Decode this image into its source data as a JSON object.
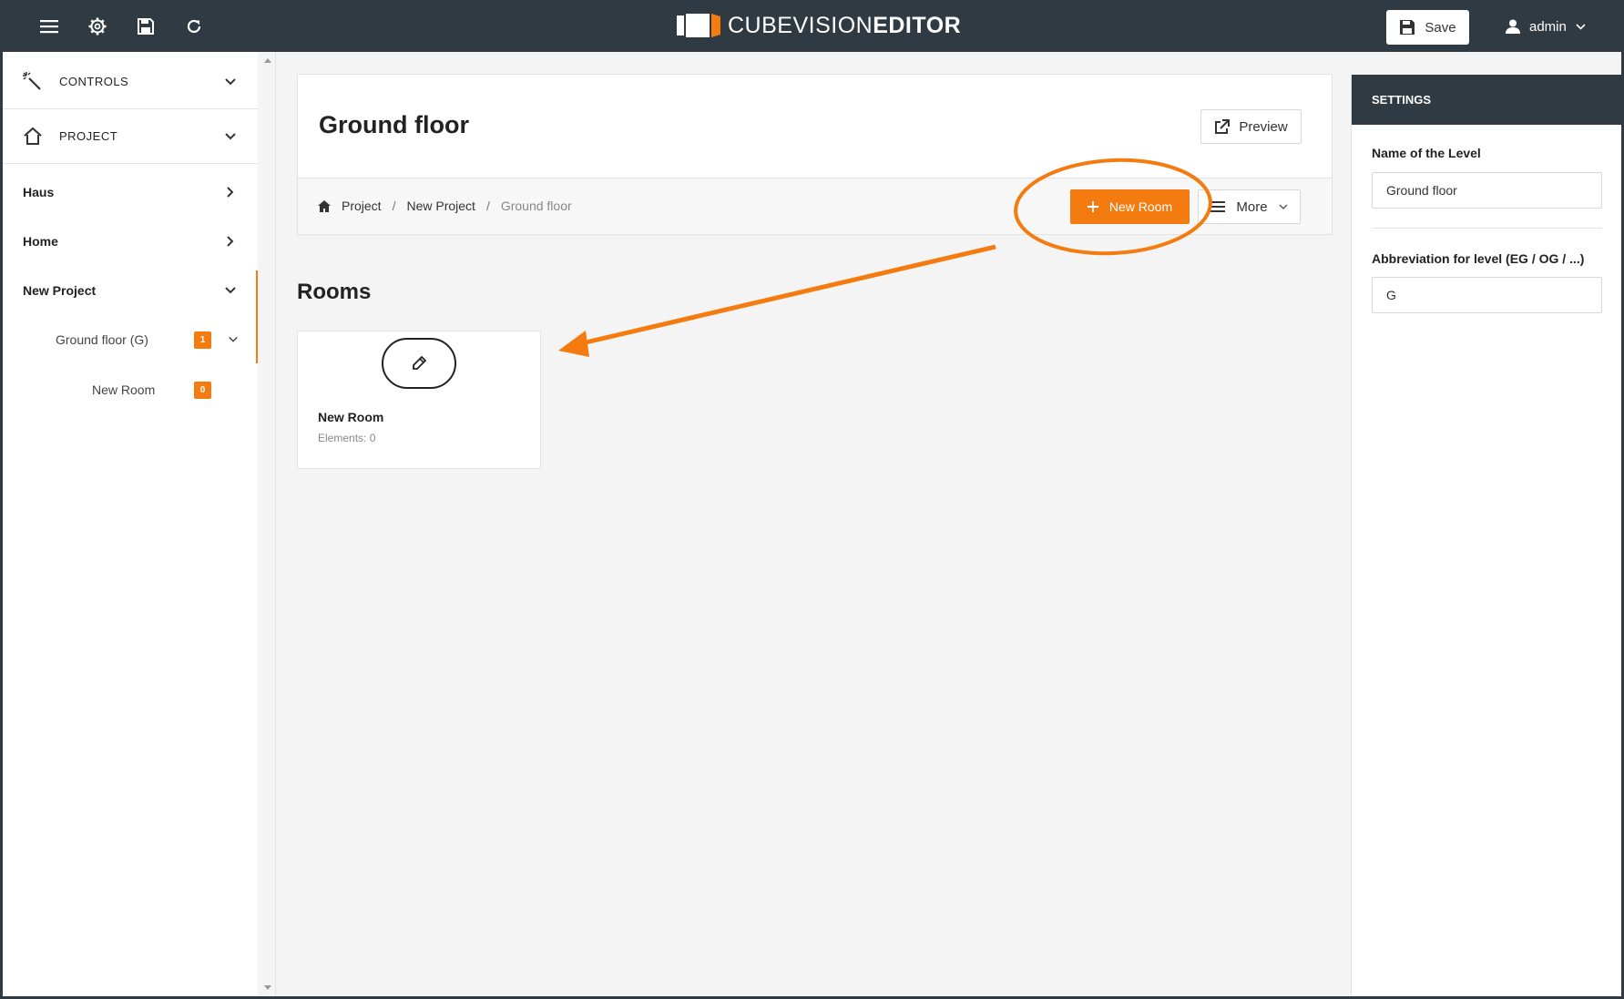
{
  "header": {
    "logo_light": "CUBEVISION",
    "logo_bold": "EDITOR",
    "save_label": "Save",
    "user_name": "admin",
    "icons": [
      "menu-icon",
      "gear-icon",
      "floppy-icon",
      "refresh-icon"
    ]
  },
  "sidebar": {
    "sections": [
      {
        "label": "CONTROLS",
        "icon": "wand-icon"
      },
      {
        "label": "PROJECT",
        "icon": "home-icon"
      }
    ],
    "items": [
      {
        "label": "Haus"
      },
      {
        "label": "Home"
      },
      {
        "label": "New Project"
      },
      {
        "label": "Ground floor (G)",
        "badge": "1"
      },
      {
        "label": "New Room",
        "badge": "0"
      }
    ]
  },
  "main": {
    "title": "Ground floor",
    "preview_label": "Preview",
    "breadcrumb": [
      "Project",
      "New Project",
      "Ground floor"
    ],
    "breadcrumb_sep": "/",
    "new_room_label": "New Room",
    "more_label": "More",
    "rooms_title": "Rooms",
    "rooms": [
      {
        "name": "New Room",
        "meta": "Elements: 0"
      }
    ]
  },
  "settings": {
    "header": "SETTINGS",
    "name_label": "Name of the Level",
    "name_value": "Ground floor",
    "abbr_label": "Abbreviation for level (EG / OG / ...)",
    "abbr_value": "G"
  },
  "colors": {
    "accent": "#f47b0f",
    "dark": "#2f3a42"
  }
}
